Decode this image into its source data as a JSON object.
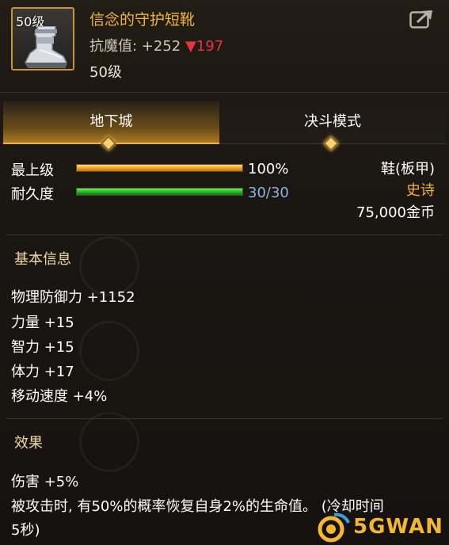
{
  "item": {
    "level_badge": "50级",
    "name": "信念的守护短靴",
    "stat_label": "抗魔值: +252",
    "stat_down_arrow": "▼",
    "stat_down_value": "197",
    "level_text": "50级"
  },
  "tabs": [
    {
      "label": "地下城",
      "active": true
    },
    {
      "label": "决斗模式",
      "active": false
    }
  ],
  "bars": {
    "top_level": {
      "label": "最上级",
      "value_text": "100%",
      "fraction": 1.0
    },
    "durability": {
      "label": "耐久度",
      "value_text": "30/30",
      "fraction": 1.0
    }
  },
  "meta": {
    "type": "鞋(板甲)",
    "rarity": "史诗",
    "price": "75,000金币"
  },
  "basic_info": {
    "title": "基本信息",
    "attributes": [
      "物理防御力 +1152",
      "力量 +15",
      "智力 +15",
      "体力 +17",
      "移动速度 +4%"
    ]
  },
  "effects": {
    "title": "效果",
    "lines": [
      "伤害 +5%",
      "被攻击时, 有50%的概率恢复自身2%的生命值。 (冷却时间",
      "5秒)"
    ]
  },
  "watermark": {
    "text": "5GWAN"
  },
  "colors": {
    "item_name": "#f2b531",
    "rarity": "#f2b531",
    "stat_down": "#e8323c",
    "durability_text": "#8fb3d9"
  },
  "icons": {
    "share": "share-icon",
    "item": "boots-icon"
  }
}
